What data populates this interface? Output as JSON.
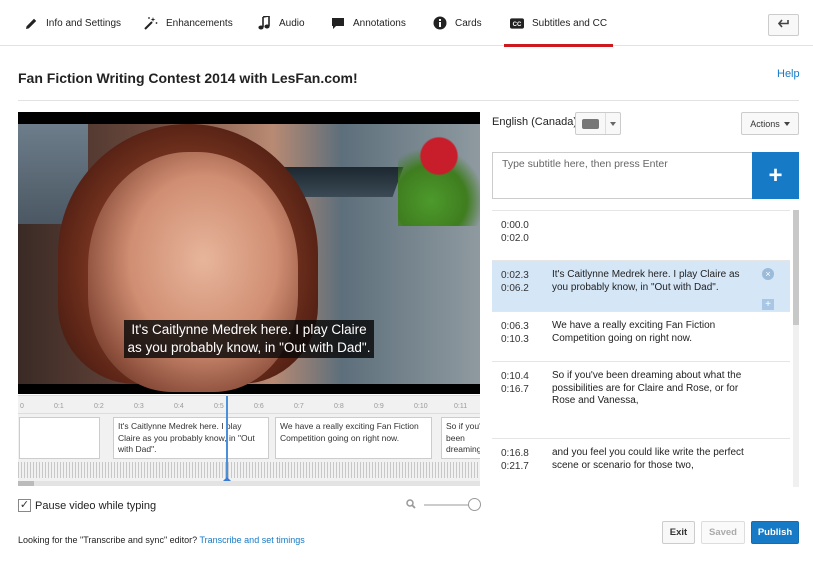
{
  "tabs": [
    {
      "label": "Info and Settings",
      "icon": "pencil-icon"
    },
    {
      "label": "Enhancements",
      "icon": "magic-wand-icon"
    },
    {
      "label": "Audio",
      "icon": "music-note-icon"
    },
    {
      "label": "Annotations",
      "icon": "speech-bubble-icon"
    },
    {
      "label": "Cards",
      "icon": "info-icon"
    },
    {
      "label": "Subtitles and CC",
      "icon": "cc-icon",
      "active": true
    }
  ],
  "header": {
    "title": "Fan Fiction Writing Contest 2014 with LesFan.com!",
    "help": "Help"
  },
  "video": {
    "caption": "It's Caitlynne Medrek here. I play Claire\nas you probably know, in \"Out with Dad\"."
  },
  "timeline": {
    "ticks": [
      "0",
      "0:1",
      "0:2",
      "0:3",
      "0:4",
      "0:5",
      "0:6",
      "0:7",
      "0:8",
      "0:9",
      "0:10",
      "0:11"
    ],
    "cues": [
      {
        "text": ""
      },
      {
        "text": "It's Caitlynne Medrek here. I play Claire as you probably know, in \"Out with Dad\"."
      },
      {
        "text": "We have a really exciting Fan Fiction Competition going on right now."
      },
      {
        "text": "So if you've been dreaming about what the possibilities"
      }
    ]
  },
  "pause_label": "Pause video while typing",
  "footer": {
    "prefix": "Looking for the \"Transcribe and sync\" editor? ",
    "link": "Transcribe and set timings"
  },
  "editor": {
    "language": "English (Canada)",
    "actions_label": "Actions",
    "input_placeholder": "Type subtitle here, then press Enter",
    "add_label": "+"
  },
  "cue_list": [
    {
      "start": "0:00.0",
      "end": "0:02.0",
      "text": ""
    },
    {
      "start": "0:02.3",
      "end": "0:06.2",
      "text": "It's Caitlynne Medrek here. I play Claire as you probably know, in \"Out with Dad\".",
      "selected": true
    },
    {
      "start": "0:06.3",
      "end": "0:10.3",
      "text": "We have a really exciting Fan Fiction Competition going on right now."
    },
    {
      "start": "0:10.4",
      "end": "0:16.7",
      "text": "So if you've been dreaming about what the possibilities are for Claire and Rose, or for Rose and Vanessa,"
    },
    {
      "start": "0:16.8",
      "end": "0:21.7",
      "text": "and you feel you could like write the perfect scene or scenario for those two,"
    }
  ],
  "buttons": {
    "exit": "Exit",
    "saved": "Saved",
    "publish": "Publish"
  },
  "colors": {
    "accent": "#167ac6",
    "active_tab": "#cc181e",
    "selected_row": "#d5e6f7"
  }
}
